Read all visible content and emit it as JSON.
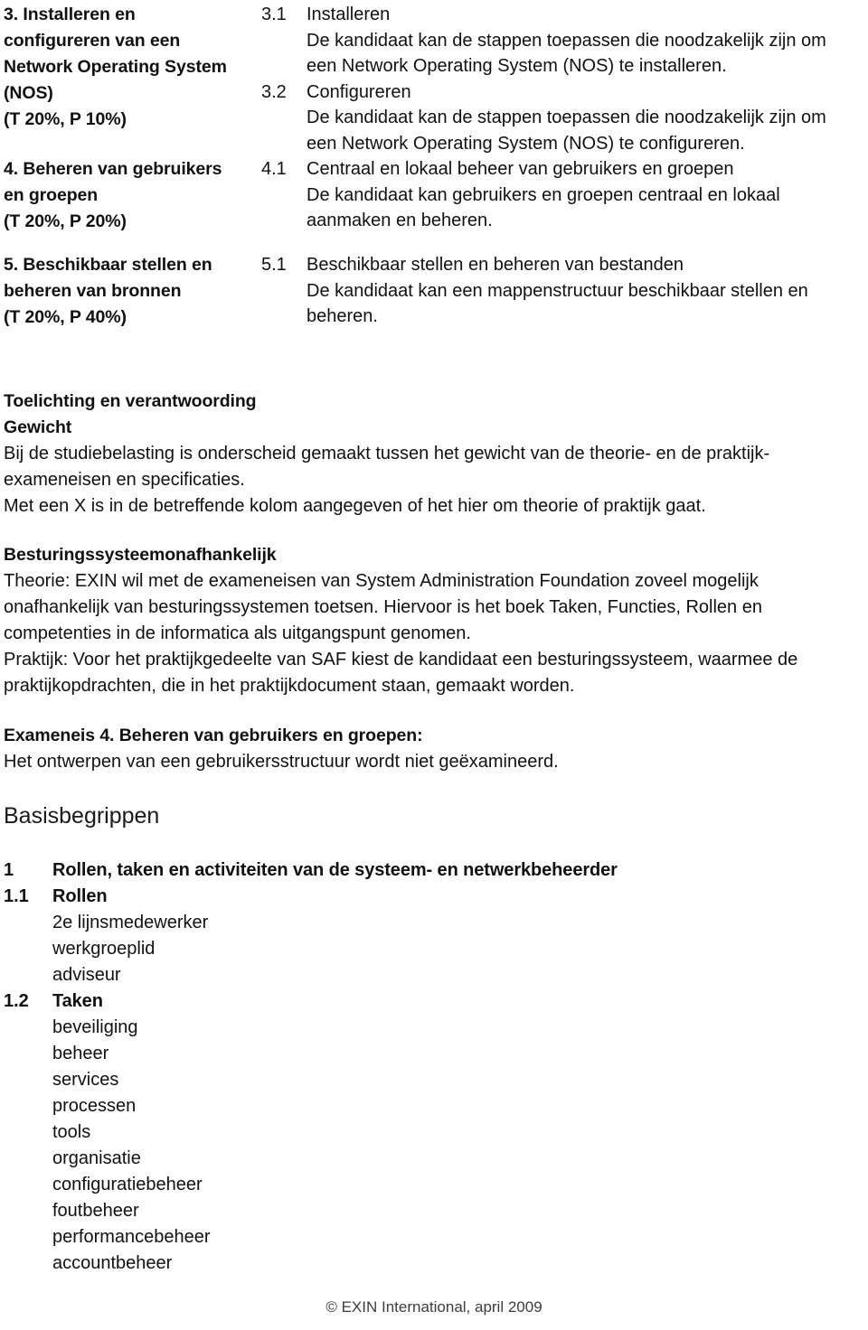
{
  "document": {
    "exam_requirements": [
      {
        "left_lines": [
          "3. Installeren en",
          "configureren van een",
          "Network Operating System",
          "(NOS)",
          "(T 20%, P 10%)"
        ],
        "specs": [
          {
            "number": "3.1",
            "title": "Installeren",
            "description_lines": [
              "De kandidaat kan de stappen toepassen die noodzakelijk zijn om",
              "een Network Operating System (NOS) te installeren."
            ]
          },
          {
            "number": "3.2",
            "title": "Configureren",
            "description_lines": [
              "De kandidaat kan de stappen toepassen die noodzakelijk zijn om",
              "een Network Operating System (NOS) te configureren."
            ]
          }
        ]
      },
      {
        "left_lines": [
          "4. Beheren van gebruikers",
          "en groepen",
          "(T 20%, P 20%)"
        ],
        "specs": [
          {
            "number": "4.1",
            "title": "Centraal en lokaal beheer van gebruikers en groepen",
            "description_lines": [
              "De kandidaat kan gebruikers en groepen centraal en lokaal",
              "aanmaken en beheren."
            ]
          }
        ]
      },
      {
        "left_lines": [
          "5. Beschikbaar stellen en",
          "beheren van bronnen",
          "(T 20%, P 40%)"
        ],
        "specs": [
          {
            "number": "5.1",
            "title": "Beschikbaar stellen en beheren van bestanden",
            "description_lines": [
              "De kandidaat kan een mappenstructuur beschikbaar stellen en",
              "beheren."
            ]
          }
        ]
      }
    ],
    "toelichting": {
      "heading": "Toelichting en verantwoording",
      "gewicht_heading": "Gewicht",
      "gewicht_lines": [
        "Bij de studiebelasting is onderscheid gemaakt tussen het gewicht van de theorie- en de praktijk-",
        "exameneisen en specificaties.",
        "Met een X is in de betreffende kolom aangegeven of het hier om theorie of praktijk gaat."
      ]
    },
    "besturingssysteem": {
      "heading": "Besturingssysteemonafhankelijk",
      "lines": [
        "Theorie: EXIN wil met de exameneisen van System Administration Foundation zoveel mogelijk",
        "onafhankelijk van besturingssystemen toetsen. Hiervoor is het boek Taken, Functies, Rollen en",
        "competenties in de informatica als uitgangspunt genomen.",
        "Praktijk: Voor het praktijkgedeelte van SAF kiest de kandidaat een besturingssysteem, waarmee de",
        "praktijkopdrachten, die in het praktijkdocument staan, gemaakt worden."
      ]
    },
    "exameneis4": {
      "heading": "Exameneis 4. Beheren van gebruikers en groepen:",
      "line": "Het ontwerpen van een gebruikersstructuur wordt niet geëxamineerd."
    },
    "basisbegrippen": {
      "heading": "Basisbegrippen",
      "items": [
        {
          "number": "1",
          "label": "Rollen, taken en activiteiten van de systeem- en netwerkbeheerder",
          "sub": []
        },
        {
          "number": "1.1",
          "label": "Rollen",
          "sub": [
            "2e lijnsmedewerker",
            "werkgroeplid",
            "adviseur"
          ]
        },
        {
          "number": "1.2",
          "label": "Taken",
          "sub": [
            "beveiliging",
            "beheer",
            "services",
            "processen",
            "tools",
            "organisatie",
            "configuratiebeheer",
            "foutbeheer",
            "performancebeheer",
            "accountbeheer"
          ]
        }
      ]
    },
    "footer": {
      "text": "© EXIN International, april 2009"
    }
  }
}
